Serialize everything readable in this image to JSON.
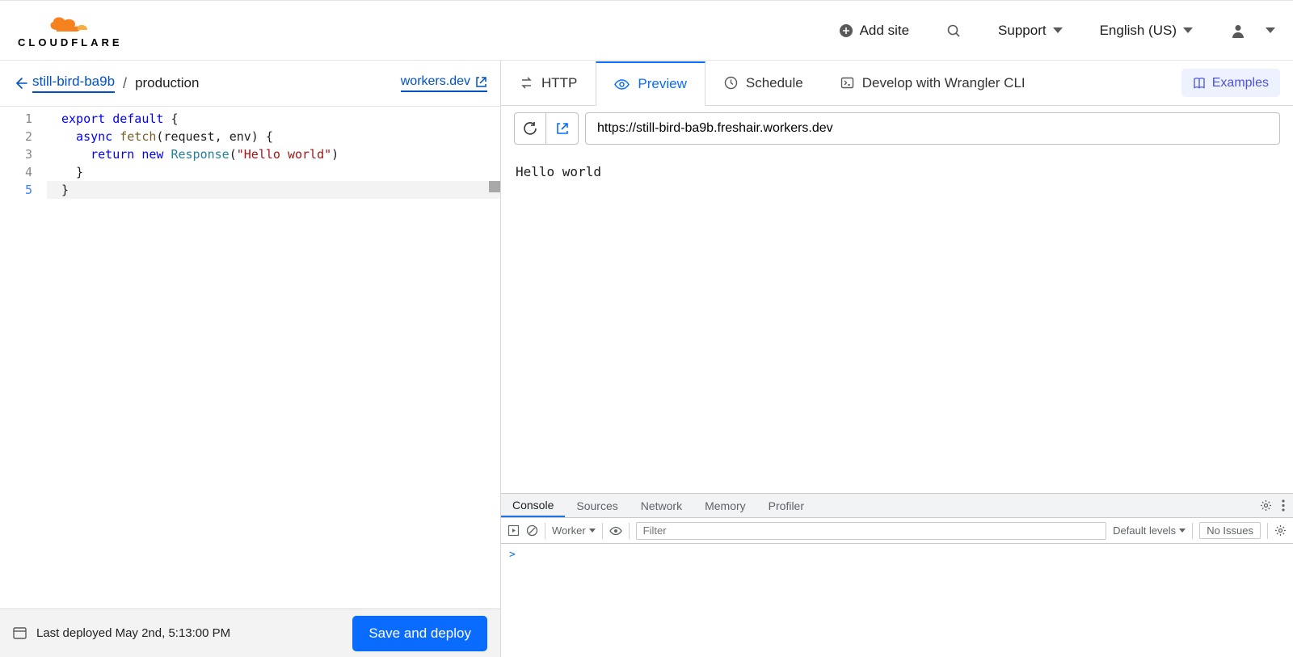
{
  "header": {
    "brand": "CLOUDFLARE",
    "add_site": "Add site",
    "support": "Support",
    "language": "English (US)"
  },
  "breadcrumb": {
    "project": "still-bird-ba9b",
    "current": "production",
    "workers_link": "workers.dev"
  },
  "editor": {
    "lines": [
      {
        "n": "1"
      },
      {
        "n": "2"
      },
      {
        "n": "3"
      },
      {
        "n": "4"
      },
      {
        "n": "5"
      }
    ],
    "code": {
      "l1a": "export",
      "l1b": " default",
      "l1c": " {",
      "l2a": "  async",
      "l2b": " fetch",
      "l2c": "(request, env) {",
      "l3a": "    return",
      "l3b": " new",
      "l3c": " Response",
      "l3d": "(",
      "l3e": "\"Hello world\"",
      "l3f": ")",
      "l4": "  }",
      "l5": "}"
    }
  },
  "footer": {
    "last_deployed": "Last deployed May 2nd, 5:13:00 PM",
    "save_label": "Save and deploy"
  },
  "tabs": {
    "http": "HTTP",
    "preview": "Preview",
    "schedule": "Schedule",
    "develop": "Develop with Wrangler CLI",
    "examples": "Examples"
  },
  "preview": {
    "url": "https://still-bird-ba9b.freshair.workers.dev",
    "response": "Hello world"
  },
  "devtools": {
    "tabs": {
      "console": "Console",
      "sources": "Sources",
      "network": "Network",
      "memory": "Memory",
      "profiler": "Profiler"
    },
    "toolbar": {
      "context": "Worker",
      "filter_placeholder": "Filter",
      "levels": "Default levels",
      "issues": "No Issues"
    },
    "prompt": ">"
  }
}
